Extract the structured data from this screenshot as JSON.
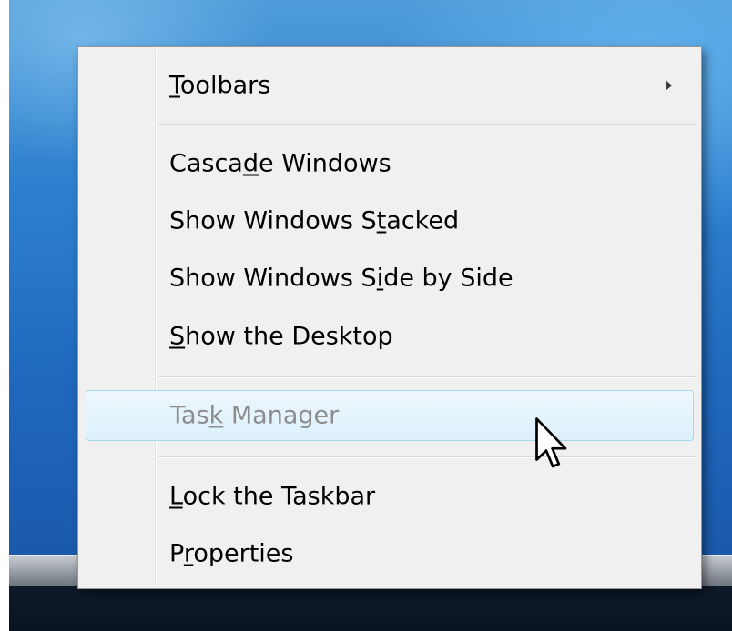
{
  "context_menu": {
    "items": [
      {
        "pre": "",
        "accel": "T",
        "post": "oolbars"
      },
      {
        "pre": "Casca",
        "accel": "d",
        "post": "e Windows"
      },
      {
        "pre": "Show Windows S",
        "accel": "t",
        "post": "acked"
      },
      {
        "pre": "Show Windows S",
        "accel": "i",
        "post": "de by Side"
      },
      {
        "pre": "",
        "accel": "S",
        "post": "how the Desktop"
      },
      {
        "pre": "Tas",
        "accel": "k",
        "post": " Manager"
      },
      {
        "pre": "",
        "accel": "L",
        "post": "ock the Taskbar"
      },
      {
        "pre": "P",
        "accel": "r",
        "post": "operties"
      }
    ],
    "toolbars_has_submenu": true,
    "task_manager_state": "disabled-hovered"
  },
  "icons": {
    "submenu": "submenu-arrow-icon",
    "cursor": "mouse-pointer-icon"
  },
  "colors": {
    "highlight_border": "#a8d8eb",
    "highlight_fill": "#dcf0fb",
    "disabled_text": "#8d8d8d"
  }
}
